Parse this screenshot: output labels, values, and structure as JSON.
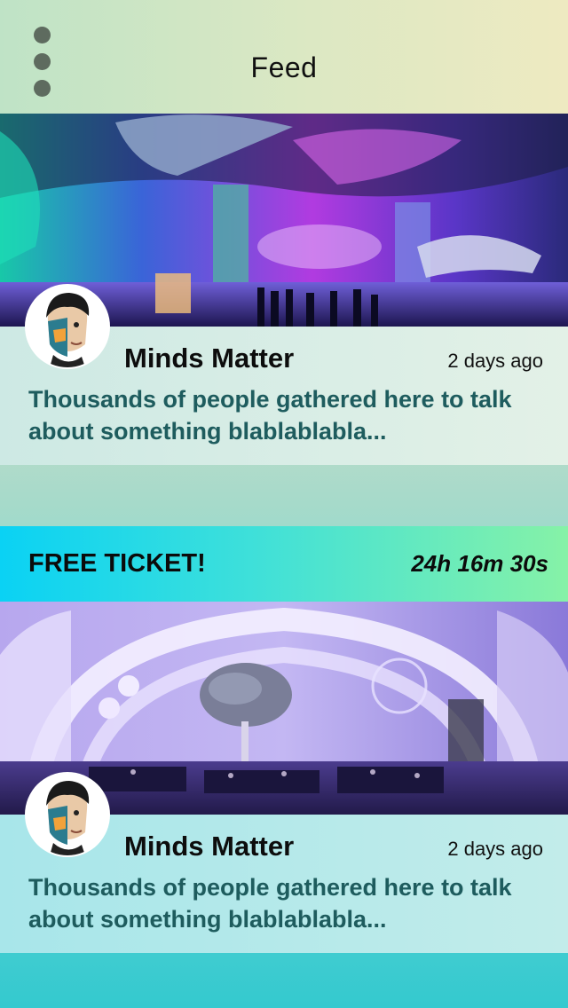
{
  "header": {
    "title": "Feed",
    "menu_icon": "kebab-menu-icon",
    "background": "#dce8c3"
  },
  "posts": [
    {
      "author": "Minds Matter",
      "time": "2 days ago",
      "text": "Thousands of people gathered here to talk about something blablablabla...",
      "image": "aquatic-themed-event-venue-photo"
    },
    {
      "author": "Minds Matter",
      "time": "2 days ago",
      "text": "Thousands of people gathered here to talk about something blablablabla...",
      "image": "banquet-hall-photo"
    }
  ],
  "ticket": {
    "label": "FREE TICKET!",
    "timer": "24h 16m 30s",
    "gradient": [
      "#0ad2f4",
      "#86f2a7"
    ]
  },
  "colors": {
    "post_text": "#1e5c5e",
    "menu_dots": "#5e6b5f"
  }
}
